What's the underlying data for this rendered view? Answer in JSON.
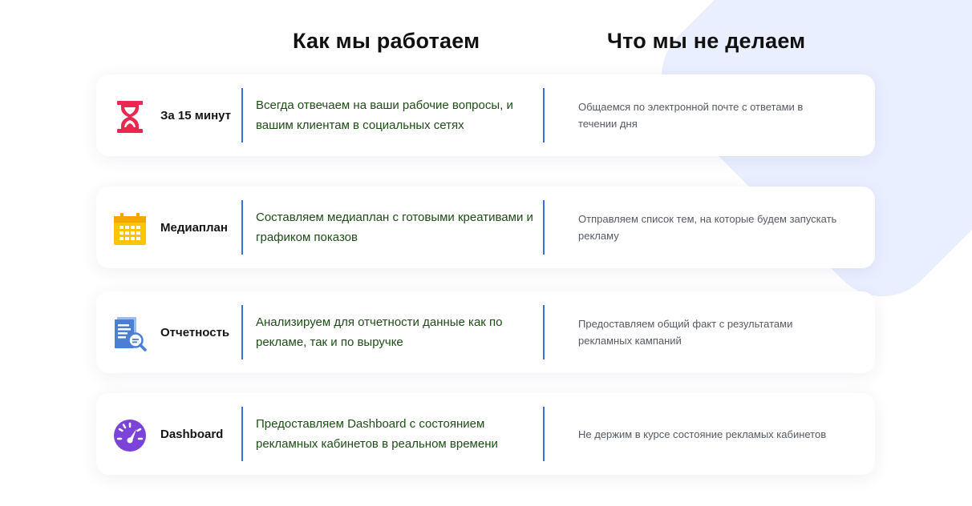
{
  "headings": {
    "left": "Как мы работаем",
    "right": "Что мы не делаем"
  },
  "colors": {
    "divider": "#3d6fd8",
    "accent_text": "#1e4d17",
    "background_shape": "#e9efff"
  },
  "rows": [
    {
      "icon": "hourglass-icon",
      "icon_color": "#e8284e",
      "title": "За 15 минут",
      "we_do": "Всегда отвечаем на ваши рабочие вопросы, и вашим клиентам в социальных сетях",
      "we_dont": "Общаемся по электронной почте с ответами в течении дня"
    },
    {
      "icon": "calendar-icon",
      "icon_color": "#ffc400",
      "title": "Медиаплан",
      "we_do": "Составляем медиаплан с готовыми креативами и графиком показов",
      "we_dont": "Отправляем список тем, на которые будем запускать рекламу"
    },
    {
      "icon": "report-search-icon",
      "icon_color": "#4a7fd4",
      "title": "Отчетность",
      "we_do": "Анализируем для отчетности данные как по рекламе, так и по выручке",
      "we_dont": "Предоставляем общий факт с результатами рекламных кампаний"
    },
    {
      "icon": "speedometer-icon",
      "icon_color": "#7b43d8",
      "title": "Dashboard",
      "we_do": "Предоставляем Dashboard с состоянием рекламных кабинетов в реальном времени",
      "we_dont": "Не держим в курсе состояние рекламых кабинетов"
    }
  ]
}
